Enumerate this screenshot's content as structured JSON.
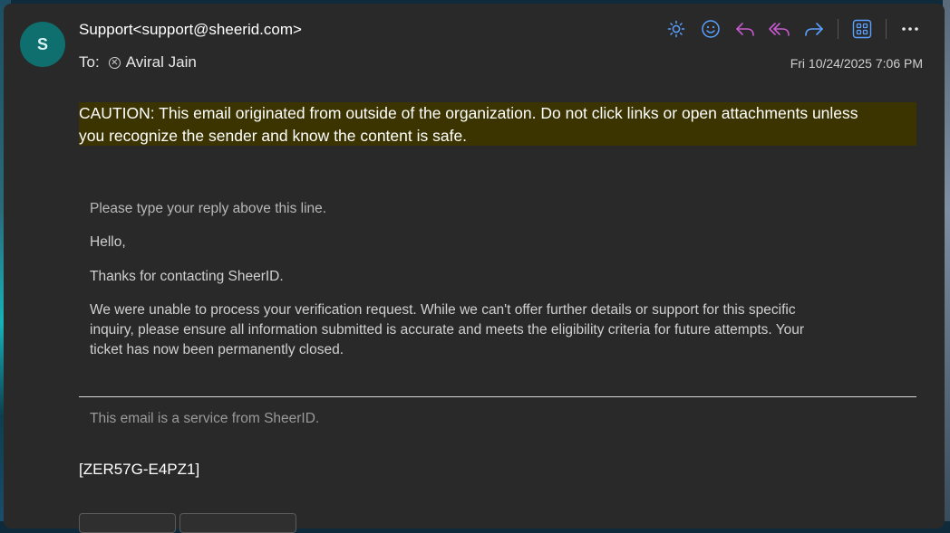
{
  "sender": {
    "avatar_letter": "S",
    "display": "Support<support@sheerid.com>"
  },
  "recipients": {
    "label": "To:",
    "name": "Aviral Jain"
  },
  "date": "Fri 10/24/2025 7:06 PM",
  "toolbar": {
    "icons": [
      "sun-icon",
      "emoji-icon",
      "reply-icon",
      "reply-all-icon",
      "forward-icon",
      "apps-icon",
      "more-icon"
    ],
    "accent_color": "#5aa0ff",
    "reply_color": "#c85ad0"
  },
  "caution": {
    "text_line1": "CAUTION: This email originated from outside of the organization. Do not click links or open attachments unless",
    "text_line2": "you recognize the sender and know the content is safe.",
    "bg_color": "#3b3400"
  },
  "body": {
    "reply_hint": "Please type your reply above this line.",
    "greeting": "Hello,",
    "thanks": "Thanks for contacting SheerID.",
    "para_line1": "We were unable to process your verification request. While we can't offer further details or support for this specific",
    "para_line2": "inquiry, please ensure all information submitted is accurate and meets the eligibility criteria for future attempts. Your",
    "para_line3": "ticket has now been permanently closed."
  },
  "footer": {
    "service_note": "This email is a service from SheerID.",
    "ticket_id": "[ZER57G-E4PZ1]"
  }
}
